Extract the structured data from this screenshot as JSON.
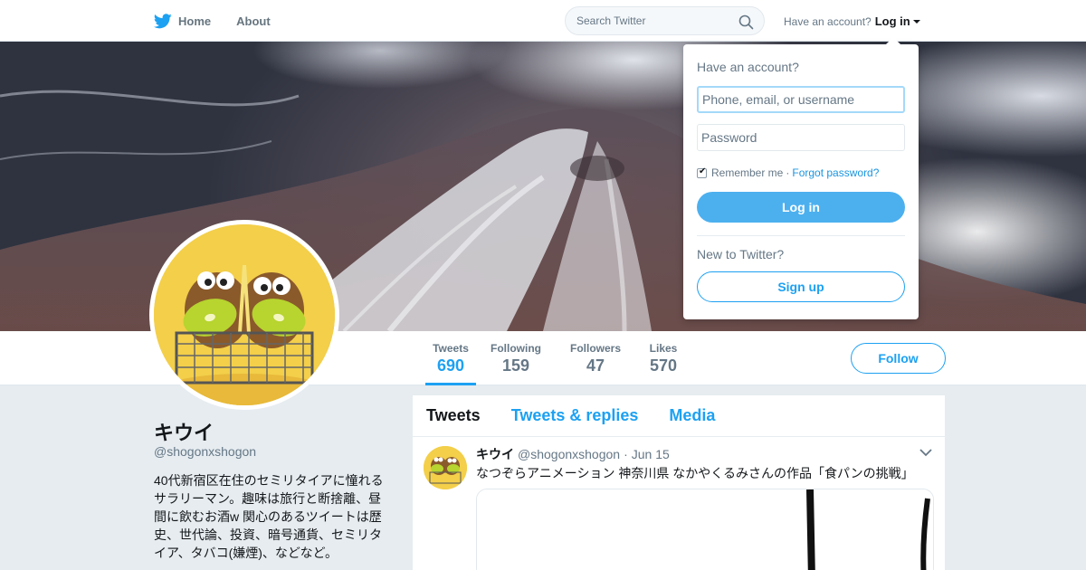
{
  "nav": {
    "home_label": "Home",
    "about_label": "About",
    "search_placeholder": "Search Twitter",
    "have_account": "Have an account?",
    "login_label": "Log in"
  },
  "login_dropdown": {
    "title": "Have an account?",
    "username_placeholder": "Phone, email, or username",
    "password_placeholder": "Password",
    "remember_me": "Remember me",
    "separator": "·",
    "forgot_password": "Forgot password?",
    "login_button": "Log in",
    "new_to_twitter": "New to Twitter?",
    "signup_button": "Sign up"
  },
  "profile": {
    "name": "キウイ",
    "handle": "@shogonxshogon",
    "bio": "40代新宿区在住のセミリタイアに憧れるサラリーマン。趣味は旅行と断捨離、昼間に飲むお酒w 関心のあるツイートは歴史、世代論、投資、暗号通貨、セミリタイア、タバコ(嫌煙)、などなど。",
    "follow_button": "Follow"
  },
  "stats": [
    {
      "label": "Tweets",
      "value": "690",
      "active": true
    },
    {
      "label": "Following",
      "value": "159",
      "active": false
    },
    {
      "label": "Followers",
      "value": "47",
      "active": false
    },
    {
      "label": "Likes",
      "value": "570",
      "active": false
    }
  ],
  "timeline": {
    "tabs": [
      "Tweets",
      "Tweets & replies",
      "Media"
    ],
    "active_tab": "Tweets",
    "tweet": {
      "name": "キウイ",
      "handle": "@shogonxshogon",
      "separator": "·",
      "date": "Jun 15",
      "text": "なつぞらアニメーション 神奈川県 なかやくるみさんの作品「食パンの挑戦」"
    }
  },
  "colors": {
    "accent": "#1da1f2",
    "login_button": "#4cb0ef",
    "avatar_bg": "#f3cf4a",
    "page_bg": "#e6ecf0"
  },
  "icons": {
    "logo": "twitter-bird-icon",
    "search": "search-icon",
    "caret": "chevron-down-icon"
  }
}
